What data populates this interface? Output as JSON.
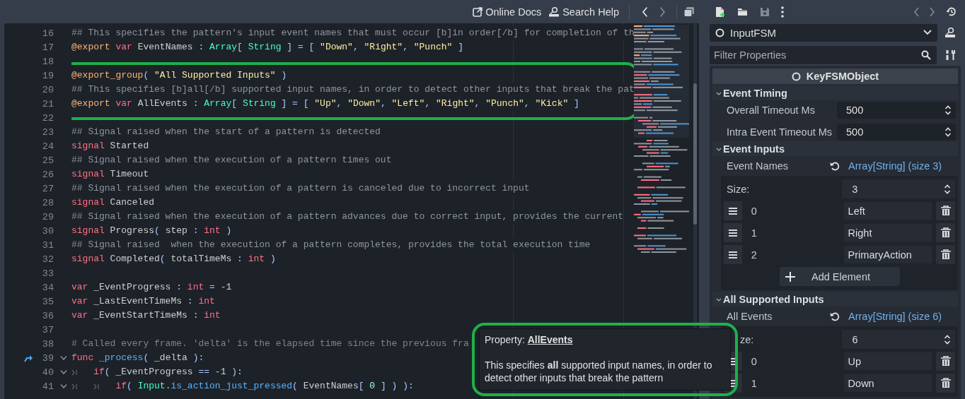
{
  "top_bar": {
    "buttons": [
      {
        "label": "Online Docs"
      },
      {
        "label": "Search Help"
      }
    ]
  },
  "editor": {
    "lines": [
      {
        "number": "16",
        "tokens": [
          {
            "kind": "doc_comment",
            "text": "## This specifies the pattern's input event names that must occur [b]in order[/b] for completion of th"
          }
        ]
      },
      {
        "number": "17",
        "tokens": [
          {
            "kind": "annotation",
            "text": "@export "
          },
          {
            "kind": "keyword",
            "text": "var"
          },
          {
            "kind": "plain",
            "text": " EventNames "
          },
          {
            "kind": "symbol",
            "text": ": "
          },
          {
            "kind": "type",
            "text": "Array"
          },
          {
            "kind": "symbol",
            "text": "[ "
          },
          {
            "kind": "type",
            "text": "String"
          },
          {
            "kind": "symbol",
            "text": " ] = [ "
          },
          {
            "kind": "string",
            "text": "\"Down\""
          },
          {
            "kind": "symbol",
            "text": ", "
          },
          {
            "kind": "string",
            "text": "\"Right\""
          },
          {
            "kind": "symbol",
            "text": ", "
          },
          {
            "kind": "string",
            "text": "\"Punch\""
          },
          {
            "kind": "symbol",
            "text": " ]"
          }
        ]
      },
      {
        "number": "18"
      },
      {
        "number": "19",
        "highlighted": true,
        "tokens": [
          {
            "kind": "annotation",
            "text": "@export_group"
          },
          {
            "kind": "symbol",
            "text": "( "
          },
          {
            "kind": "string",
            "text": "\"All Supported Inputs\""
          },
          {
            "kind": "symbol",
            "text": " )"
          }
        ]
      },
      {
        "number": "20",
        "highlighted": true,
        "tokens": [
          {
            "kind": "doc_comment",
            "text": "## This specifies [b]all[/b] supported input names, in order to detect other inputs that break the pat"
          }
        ]
      },
      {
        "number": "21",
        "highlighted": true,
        "tokens": [
          {
            "kind": "annotation",
            "text": "@export "
          },
          {
            "kind": "keyword",
            "text": "var"
          },
          {
            "kind": "plain",
            "text": " AllEvents "
          },
          {
            "kind": "symbol",
            "text": ": "
          },
          {
            "kind": "type",
            "text": "Array"
          },
          {
            "kind": "symbol",
            "text": "[ "
          },
          {
            "kind": "type",
            "text": "String"
          },
          {
            "kind": "symbol",
            "text": " ] = [ "
          },
          {
            "kind": "string",
            "text": "\"Up\""
          },
          {
            "kind": "symbol",
            "text": ", "
          },
          {
            "kind": "string",
            "text": "\"Down\""
          },
          {
            "kind": "symbol",
            "text": ", "
          },
          {
            "kind": "string",
            "text": "\"Left\""
          },
          {
            "kind": "symbol",
            "text": ", "
          },
          {
            "kind": "string",
            "text": "\"Right\""
          },
          {
            "kind": "symbol",
            "text": ", "
          },
          {
            "kind": "string",
            "text": "\"Punch\""
          },
          {
            "kind": "symbol",
            "text": ", "
          },
          {
            "kind": "string",
            "text": "\"Kick\""
          },
          {
            "kind": "symbol",
            "text": " ]"
          }
        ]
      },
      {
        "number": "22"
      },
      {
        "number": "23",
        "tokens": [
          {
            "kind": "doc_comment",
            "text": "## Signal raised when the start of a pattern is detected"
          }
        ]
      },
      {
        "number": "24",
        "tokens": [
          {
            "kind": "keyword",
            "text": "signal"
          },
          {
            "kind": "plain",
            "text": " Started"
          }
        ]
      },
      {
        "number": "25",
        "tokens": [
          {
            "kind": "doc_comment",
            "text": "## Signal raised when the execution of a pattern times out"
          }
        ]
      },
      {
        "number": "26",
        "tokens": [
          {
            "kind": "keyword",
            "text": "signal"
          },
          {
            "kind": "plain",
            "text": " Timeout"
          }
        ]
      },
      {
        "number": "27",
        "tokens": [
          {
            "kind": "doc_comment",
            "text": "## Signal raised when the execution of a pattern is canceled due to incorrect input"
          }
        ]
      },
      {
        "number": "28",
        "tokens": [
          {
            "kind": "keyword",
            "text": "signal"
          },
          {
            "kind": "plain",
            "text": " Canceled"
          }
        ]
      },
      {
        "number": "29",
        "tokens": [
          {
            "kind": "doc_comment",
            "text": "## Signal raised when the execution of a pattern advances due to correct input, provides the current"
          }
        ]
      },
      {
        "number": "30",
        "tokens": [
          {
            "kind": "keyword",
            "text": "signal"
          },
          {
            "kind": "plain",
            "text": " Progress"
          },
          {
            "kind": "symbol",
            "text": "( "
          },
          {
            "kind": "plain",
            "text": "step "
          },
          {
            "kind": "symbol",
            "text": ": "
          },
          {
            "kind": "keyword",
            "text": "int"
          },
          {
            "kind": "symbol",
            "text": " )"
          }
        ]
      },
      {
        "number": "31",
        "tokens": [
          {
            "kind": "doc_comment",
            "text": "## Signal raised  when the execution of a pattern completes, provides the total execution time"
          }
        ]
      },
      {
        "number": "32",
        "tokens": [
          {
            "kind": "keyword",
            "text": "signal"
          },
          {
            "kind": "plain",
            "text": " Completed"
          },
          {
            "kind": "symbol",
            "text": "( "
          },
          {
            "kind": "plain",
            "text": "totalTimeMs "
          },
          {
            "kind": "symbol",
            "text": ": "
          },
          {
            "kind": "keyword",
            "text": "int"
          },
          {
            "kind": "symbol",
            "text": " )"
          }
        ]
      },
      {
        "number": "33"
      },
      {
        "number": "34",
        "tokens": [
          {
            "kind": "keyword",
            "text": "var"
          },
          {
            "kind": "plain",
            "text": " _EventProgress "
          },
          {
            "kind": "symbol",
            "text": ": "
          },
          {
            "kind": "keyword",
            "text": "int"
          },
          {
            "kind": "symbol",
            "text": " = "
          },
          {
            "kind": "plain",
            "text": "-1"
          }
        ]
      },
      {
        "number": "35",
        "tokens": [
          {
            "kind": "keyword",
            "text": "var"
          },
          {
            "kind": "plain",
            "text": " _LastEventTimeMs "
          },
          {
            "kind": "symbol",
            "text": ": "
          },
          {
            "kind": "keyword",
            "text": "int"
          }
        ]
      },
      {
        "number": "36",
        "tokens": [
          {
            "kind": "keyword",
            "text": "var"
          },
          {
            "kind": "plain",
            "text": " _EventStartTimeMs "
          },
          {
            "kind": "symbol",
            "text": ": "
          },
          {
            "kind": "keyword",
            "text": "int"
          }
        ]
      },
      {
        "number": "37"
      },
      {
        "number": "38",
        "tokens": [
          {
            "kind": "comment",
            "text": "# Called every frame. 'delta' is the elapsed time since the previous fra"
          }
        ]
      },
      {
        "number": "39",
        "foldable": true,
        "override": true,
        "tokens": [
          {
            "kind": "keyword",
            "text": "func "
          },
          {
            "kind": "function",
            "text": "_process"
          },
          {
            "kind": "symbol",
            "text": "( "
          },
          {
            "kind": "plain",
            "text": "_delta "
          },
          {
            "kind": "symbol",
            "text": "):"
          }
        ]
      },
      {
        "number": "40",
        "foldable": true,
        "tokens": [
          {
            "kind": "tab"
          },
          {
            "kind": "keyword",
            "text": "if"
          },
          {
            "kind": "symbol",
            "text": "( "
          },
          {
            "kind": "plain",
            "text": "_EventProgress "
          },
          {
            "kind": "symbol",
            "text": "== "
          },
          {
            "kind": "plain",
            "text": "-1 "
          },
          {
            "kind": "symbol",
            "text": "):"
          }
        ]
      },
      {
        "number": "41",
        "foldable": true,
        "tokens": [
          {
            "kind": "tab"
          },
          {
            "kind": "tab"
          },
          {
            "kind": "keyword",
            "text": "if"
          },
          {
            "kind": "symbol",
            "text": "( "
          },
          {
            "kind": "type",
            "text": "Input"
          },
          {
            "kind": "symbol",
            "text": "."
          },
          {
            "kind": "function",
            "text": "is_action_just_pressed"
          },
          {
            "kind": "symbol",
            "text": "( "
          },
          {
            "kind": "plain",
            "text": "EventNames"
          },
          {
            "kind": "symbol",
            "text": "[ "
          },
          {
            "kind": "number",
            "text": "0"
          },
          {
            "kind": "symbol",
            "text": " ] ) ):"
          }
        ]
      }
    ]
  },
  "tooltip": {
    "highlighted": true,
    "title": "Property: **AllEvents**",
    "text": "This specifies **all** supported input names, in order to detect other inputs that break the pattern"
  },
  "inspector": {
    "object": "InputFSM",
    "filter": {
      "placeholder": "Filter Properties"
    },
    "header": "KeyFSMObject",
    "sections": [
      {
        "title": "Event Timing",
        "expanded": true,
        "properties": [
          {
            "kind": "number",
            "label": "Overall Timeout Ms",
            "value": "500"
          },
          {
            "kind": "number",
            "label": "Intra Event Timeout Ms",
            "value": "500"
          }
        ]
      },
      {
        "title": "Event Inputs",
        "expanded": true,
        "properties": [
          {
            "kind": "array",
            "label": "Event Names",
            "value": "Array[String] (size 3)",
            "size_label": "Size:",
            "size": "3",
            "items": [
              {
                "index": "0",
                "value": "Left"
              },
              {
                "index": "1",
                "value": "Right"
              },
              {
                "index": "2",
                "value": "PrimaryAction"
              }
            ],
            "add_label": "Add Element"
          }
        ]
      },
      {
        "title": "All Supported Inputs",
        "expanded": true,
        "properties": [
          {
            "kind": "array",
            "label": "All Events",
            "value": "Array[String] (size 6)",
            "size_label": "ze:",
            "size_label_covered": true,
            "size": "6",
            "items": [
              {
                "index": "0",
                "value": "Up"
              },
              {
                "index": "1",
                "value": "Down"
              }
            ]
          }
        ]
      }
    ]
  }
}
